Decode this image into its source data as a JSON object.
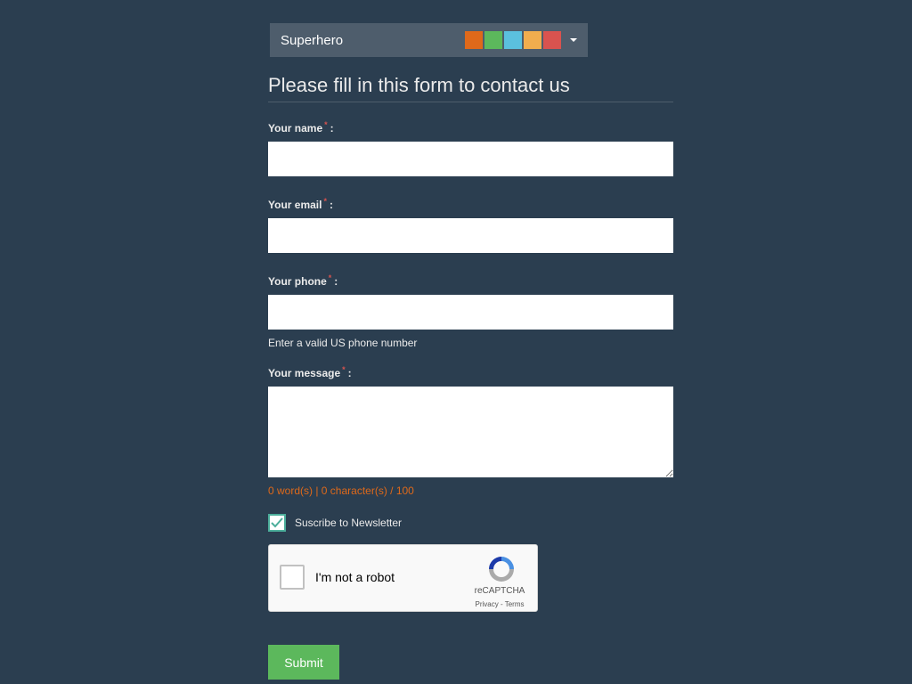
{
  "theme": {
    "name": "Superhero",
    "swatches": [
      "#df691a",
      "#5cb85c",
      "#5bc0de",
      "#f0ad4e",
      "#d9534f"
    ]
  },
  "form": {
    "legend": "Please fill in this form to contact us",
    "required_marker": "*",
    "name_label": "Your name",
    "email_label": "Your email",
    "phone_label": "Your phone",
    "phone_help": "Enter a valid US phone number",
    "message_label": "Your message",
    "counter": "0 word(s) | 0 character(s) / 100",
    "newsletter_label": "Suscribe to Newsletter",
    "newsletter_checked": true,
    "submit_label": "Submit"
  },
  "recaptcha": {
    "label": "I'm not a robot",
    "brand": "reCAPTCHA",
    "links": "Privacy - Terms"
  },
  "colors": {
    "background": "#2b3e50",
    "accent": "#df691a",
    "success": "#5cb85c",
    "required": "#d9534f"
  }
}
